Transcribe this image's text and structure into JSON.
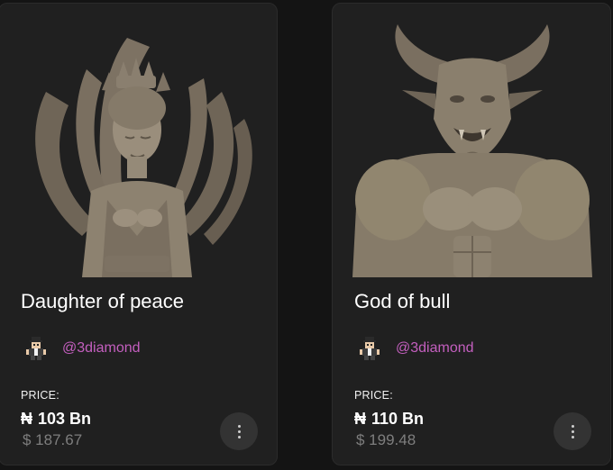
{
  "cards": [
    {
      "title": "Daughter of peace",
      "creator": "@3diamond",
      "price_label": "PRICE:",
      "currency_symbol": "₦",
      "price": "103 Bn",
      "price_usd": "$ 187.67",
      "image_icon": "sculpture-geisha-image",
      "more_icon": "more-vertical-icon"
    },
    {
      "title": "God of bull",
      "creator": "@3diamond",
      "price_label": "PRICE:",
      "currency_symbol": "₦",
      "price": "110 Bn",
      "price_usd": "$ 199.48",
      "image_icon": "sculpture-minotaur-image",
      "more_icon": "more-vertical-icon"
    }
  ],
  "colors": {
    "background": "#141414",
    "card": "#202020",
    "creator_handle": "#c45fbf",
    "usd_price": "#7e7e7e",
    "more_button": "#333333"
  }
}
